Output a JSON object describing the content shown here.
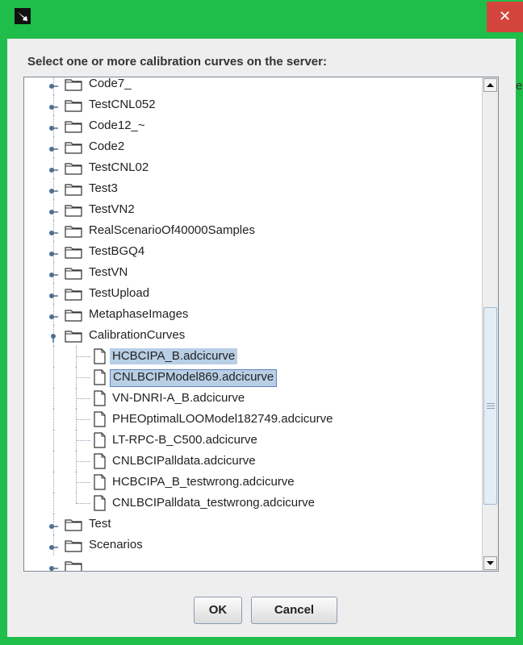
{
  "dialog": {
    "close_glyph": "✕",
    "prompt": "Select one or more calibration curves on the server:",
    "accent_color": "#1fbd4a",
    "selection_color": "#b8cfe5"
  },
  "tree": {
    "folders_top": [
      {
        "label": "Code7_"
      },
      {
        "label": "TestCNL052"
      },
      {
        "label": "Code12_~"
      },
      {
        "label": "Code2"
      },
      {
        "label": "TestCNL02"
      },
      {
        "label": "Test3"
      },
      {
        "label": "TestVN2"
      },
      {
        "label": "RealScenarioOf40000Samples"
      },
      {
        "label": "TestBGQ4"
      },
      {
        "label": "TestVN"
      },
      {
        "label": "TestUpload"
      },
      {
        "label": "MetaphaseImages"
      }
    ],
    "expanded_folder": {
      "label": "CalibrationCurves"
    },
    "files": [
      {
        "label": "HCBCIPA_B.adcicurve",
        "selected": true
      },
      {
        "label": "CNLBCIPModel869.adcicurve",
        "selected": true,
        "focused": true
      },
      {
        "label": "VN-DNRI-A_B.adcicurve"
      },
      {
        "label": "PHEOptimalLOOModel182749.adcicurve"
      },
      {
        "label": "LT-RPC-B_C500.adcicurve"
      },
      {
        "label": "CNLBCIPalldata.adcicurve"
      },
      {
        "label": "HCBCIPA_B_testwrong.adcicurve"
      },
      {
        "label": "CNLBCIPalldata_testwrong.adcicurve"
      }
    ],
    "folders_bottom": [
      {
        "label": "Test"
      },
      {
        "label": "Scenarios"
      }
    ]
  },
  "buttons": {
    "ok": "OK",
    "cancel": "Cancel"
  },
  "icons": {
    "app": "app-icon",
    "folder": "folder-icon",
    "file": "file-icon",
    "expand": "expand-toggle-icon",
    "collapse": "collapse-toggle-icon",
    "scroll_up": "scroll-up-arrow-icon",
    "scroll_down": "scroll-down-arrow-icon"
  },
  "background_fragment": "e"
}
